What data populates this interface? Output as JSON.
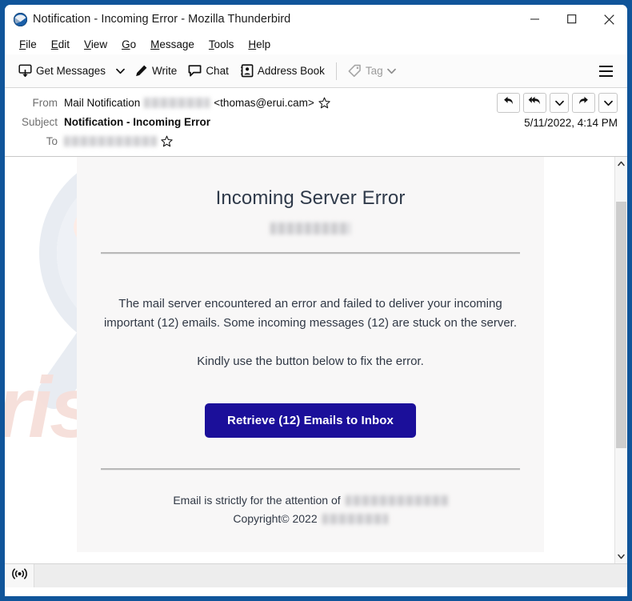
{
  "window": {
    "title": "Notification - Incoming Error - Mozilla Thunderbird",
    "app_icon": "thunderbird-icon",
    "controls": {
      "minimize": "minimize-icon",
      "maximize": "maximize-icon",
      "close": "close-icon"
    }
  },
  "menubar": {
    "items": [
      {
        "label": "File",
        "accel": "F",
        "rest": "ile"
      },
      {
        "label": "Edit",
        "accel": "E",
        "rest": "dit"
      },
      {
        "label": "View",
        "accel": "V",
        "rest": "iew"
      },
      {
        "label": "Go",
        "accel": "G",
        "rest": "o"
      },
      {
        "label": "Message",
        "accel": "M",
        "rest": "essage"
      },
      {
        "label": "Tools",
        "accel": "T",
        "rest": "ools"
      },
      {
        "label": "Help",
        "accel": "H",
        "rest": "elp"
      }
    ]
  },
  "toolbar": {
    "get_messages": "Get Messages",
    "write": "Write",
    "chat": "Chat",
    "address_book": "Address Book",
    "tag": "Tag",
    "tag_disabled": true,
    "app_menu": "hamburger-icon"
  },
  "message_header": {
    "from_label": "From",
    "from_name": "Mail Notification",
    "from_redacted_width": 82,
    "from_address": "<thomas@erui.cam>",
    "subject_label": "Subject",
    "subject": "Notification - Incoming Error",
    "to_label": "To",
    "to_redacted_width": 116,
    "date": "5/11/2022, 4:14 PM",
    "actions": [
      {
        "name": "reply-button",
        "icon": "reply-arrow-icon"
      },
      {
        "name": "reply-all-button",
        "icon": "reply-all-arrow-icon"
      },
      {
        "name": "reply-menu-button",
        "icon": "chevron-down-icon"
      },
      {
        "name": "forward-button",
        "icon": "forward-arrow-icon"
      },
      {
        "name": "more-actions-button",
        "icon": "chevron-down-icon"
      }
    ]
  },
  "email": {
    "title": "Incoming Server Error",
    "domain_redacted_width": 100,
    "paragraph_1": "The mail server encountered an error and failed to deliver your incoming important (12) emails. Some incoming messages (12) are stuck on the server.",
    "paragraph_2": "Kindly use the button below to fix the error.",
    "cta_label": "Retrieve (12) Emails to Inbox",
    "cta_color": "#1b0f9a",
    "footer_line_1": "Email is strictly for the attention of",
    "footer_line_1_redacted_width": 128,
    "footer_line_2": "Copyright© 2022",
    "footer_line_2_redacted_width": 82,
    "watermark_text": "risk.com"
  },
  "scrollbar": {
    "up": "chevron-up-icon",
    "down": "chevron-down-icon"
  },
  "statusbar": {
    "icon": "broadcast-icon",
    "text": ""
  }
}
